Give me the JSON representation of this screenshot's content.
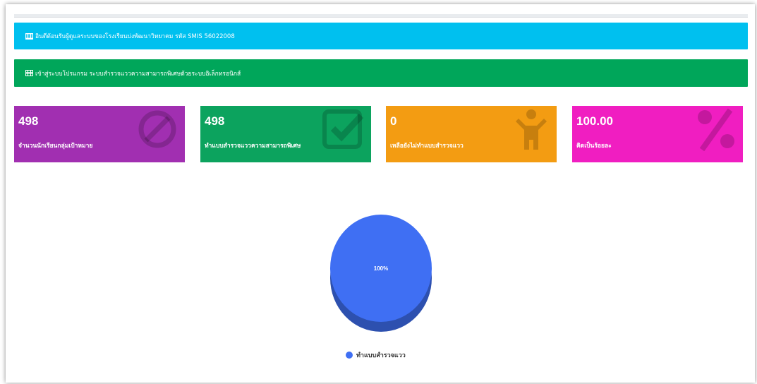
{
  "banners": {
    "welcome": "อินดีต้อนรับผู้ดูแลระบบของโรงเรียนบ่งพัฒนาวิทยาคม รหัส SMIS 56022008",
    "program": "เข้าสู่ระบบโปรแกรม ระบบสำรวจแววความสามารถพิเศษด้วยระบบอิเล็กทรอนิกส์"
  },
  "cards": [
    {
      "value": "498",
      "label": "จำนวนนักเรียนกลุ่มเป้าหมาย",
      "icon": "ban-icon",
      "color": "#a12fb1"
    },
    {
      "value": "498",
      "label": "ทำแบบสำรวจแววความสามารถพิเศษ",
      "icon": "check-square-icon",
      "color": "#0ca35e"
    },
    {
      "value": "0",
      "label": "เหลือยังไม่ทำแบบสำรวจแวว",
      "icon": "child-icon",
      "color": "#f39c12"
    },
    {
      "value": "100.00",
      "label": "คิดเป็นร้อยละ",
      "icon": "percent-icon",
      "color": "#f01ec1"
    }
  ],
  "chart_data": {
    "type": "pie",
    "slices": [
      {
        "label": "ทำแบบสำรวจแวว",
        "value": 100,
        "color": "#3f6ff3"
      }
    ],
    "data_labels": [
      "100%"
    ],
    "legend_position": "bottom"
  }
}
